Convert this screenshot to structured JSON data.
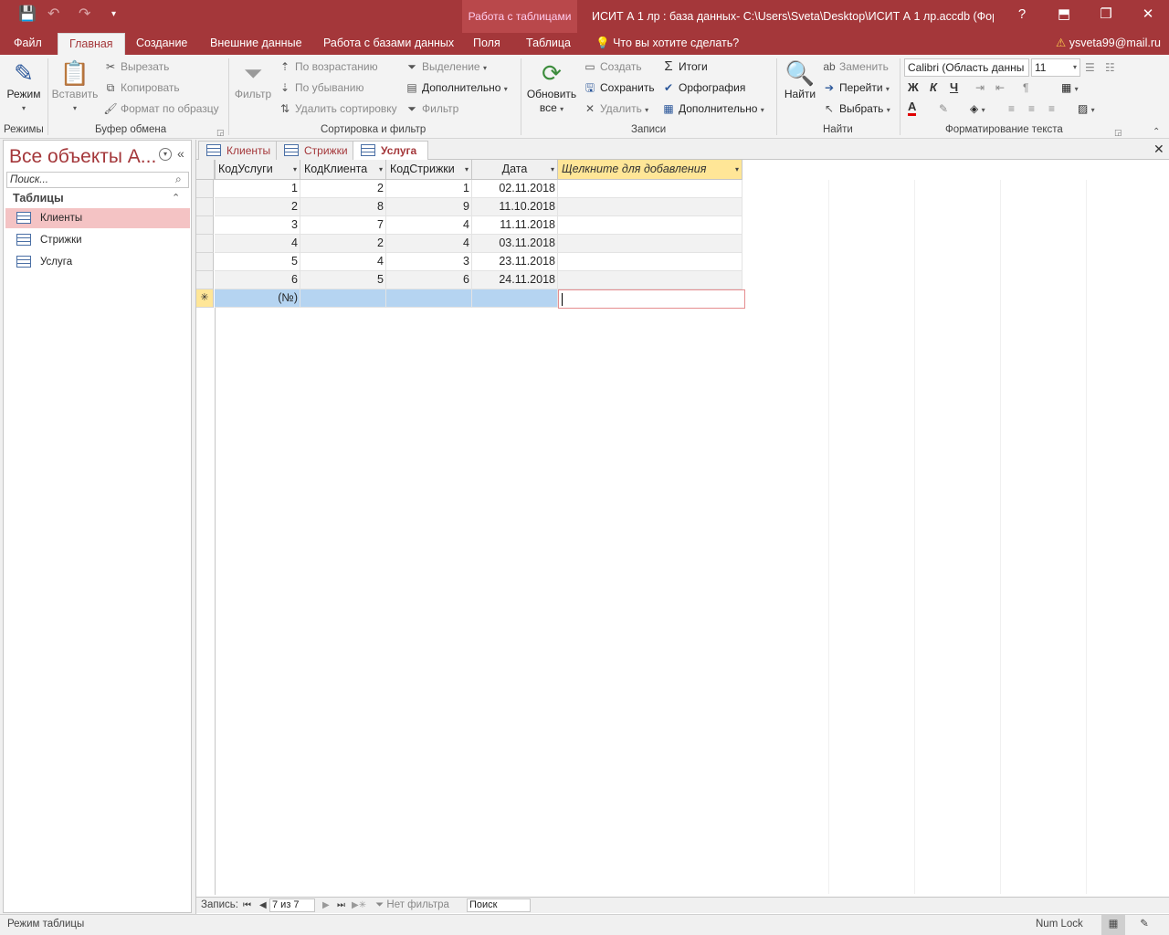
{
  "window": {
    "context_tab": "Работа с таблицами",
    "title": "ИСИТ А 1 лр : база данных- C:\\Users\\Sveta\\Desktop\\ИСИТ А 1 лр.accdb (Фор...",
    "help": "?",
    "minimize": "—",
    "restore": "❐",
    "close": "✕"
  },
  "ribbon_tabs": {
    "file": "Файл",
    "home": "Главная",
    "create": "Создание",
    "external": "Внешние данные",
    "dbtools": "Работа с базами данных",
    "fields": "Поля",
    "table": "Таблица",
    "tellme": "Что вы хотите сделать?",
    "account": "ysveta99@mail.ru"
  },
  "ribbon": {
    "views": {
      "mode": "Режим",
      "label": "Режимы"
    },
    "clipboard": {
      "paste": "Вставить",
      "cut": "Вырезать",
      "copy": "Копировать",
      "format_painter": "Формат по образцу",
      "label": "Буфер обмена"
    },
    "sort_filter": {
      "filter": "Фильтр",
      "ascending": "По возрастанию",
      "descending": "По убыванию",
      "remove_sort": "Удалить сортировку",
      "selection": "Выделение",
      "advanced": "Дополнительно",
      "toggle_filter": "Фильтр",
      "label": "Сортировка и фильтр"
    },
    "records": {
      "refresh": "Обновить",
      "refresh2": "все",
      "new": "Создать",
      "save": "Сохранить",
      "delete": "Удалить",
      "totals": "Итоги",
      "spelling": "Орфография",
      "more": "Дополнительно",
      "label": "Записи"
    },
    "find": {
      "find": "Найти",
      "replace": "Заменить",
      "goto": "Перейти",
      "select": "Выбрать",
      "label": "Найти"
    },
    "text_format": {
      "font": "Calibri (Область данны",
      "size": "11",
      "bold": "Ж",
      "italic": "К",
      "underline": "Ч",
      "font_color": "A",
      "label": "Форматирование текста"
    }
  },
  "nav": {
    "title": "Все объекты A...",
    "search_placeholder": "Поиск...",
    "section": "Таблицы",
    "items": [
      "Клиенты",
      "Стрижки",
      "Услуга"
    ]
  },
  "doc_tabs": [
    "Клиенты",
    "Стрижки",
    "Услуга"
  ],
  "table": {
    "columns": [
      "КодУслуги",
      "КодКлиента",
      "КодСтрижки",
      "Дата",
      "Щелкните для добавления"
    ],
    "rows": [
      [
        "1",
        "2",
        "1",
        "02.11.2018"
      ],
      [
        "2",
        "8",
        "9",
        "11.10.2018"
      ],
      [
        "3",
        "7",
        "4",
        "11.11.2018"
      ],
      [
        "4",
        "2",
        "4",
        "03.11.2018"
      ],
      [
        "5",
        "4",
        "3",
        "23.11.2018"
      ],
      [
        "6",
        "5",
        "6",
        "24.11.2018"
      ]
    ],
    "new_row_marker": "✳",
    "new_row_placeholder": "(№)"
  },
  "record_nav": {
    "label": "Запись:",
    "position": "7 из 7",
    "filter": "Нет фильтра",
    "search": "Поиск"
  },
  "status": {
    "mode": "Режим таблицы",
    "numlock": "Num Lock"
  }
}
